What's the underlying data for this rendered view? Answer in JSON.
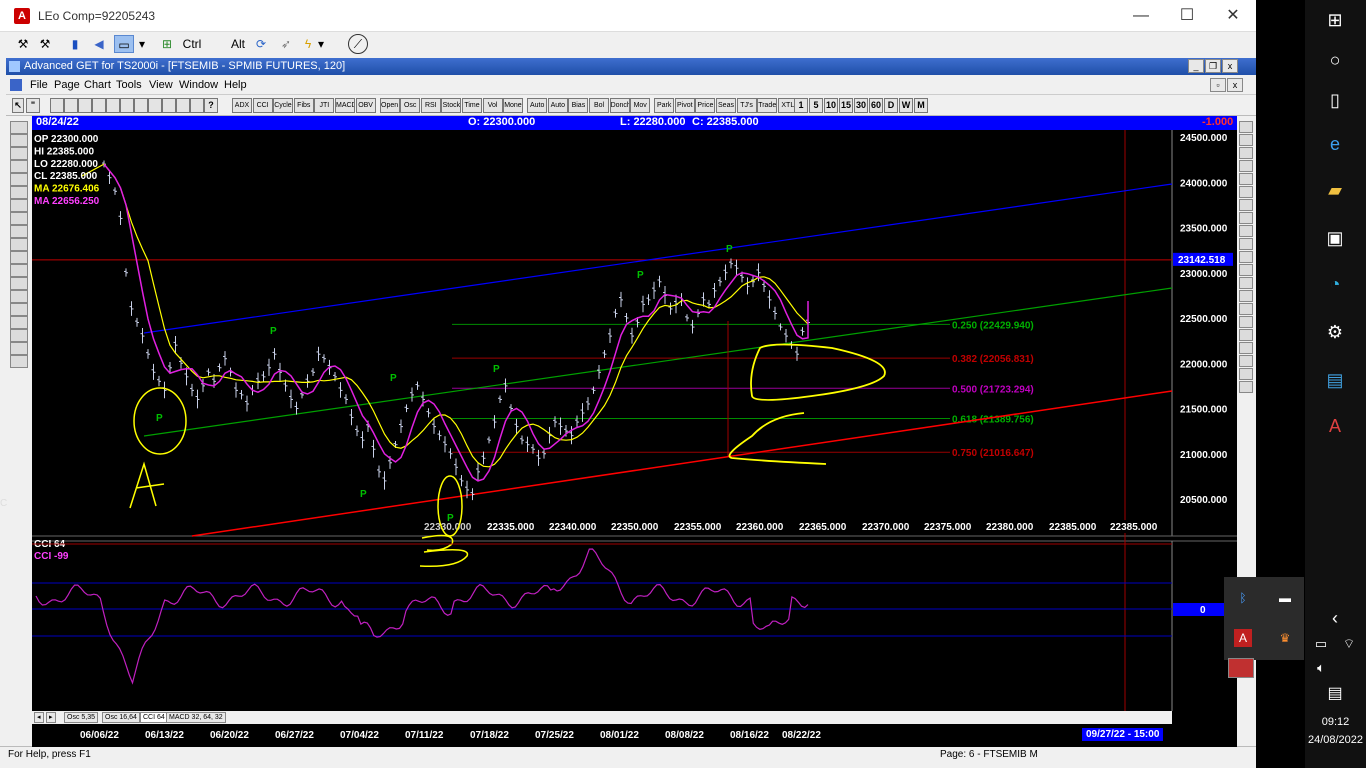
{
  "window": {
    "title": "LEo Comp=92205243",
    "app_icon": "A",
    "minimize": "—",
    "maximize": "☐",
    "close": "✕"
  },
  "toolbar": {
    "ctrl_label": "Ctrl",
    "alt_label": "Alt"
  },
  "inner_window": {
    "title": "Advanced GET for TS2000i - [FTSEMIB - SPMIB FUTURES, 120]"
  },
  "menu": [
    "File",
    "Page",
    "Chart",
    "Tools",
    "View",
    "Window",
    "Help"
  ],
  "indicator_buttons": [
    "ADX DMI",
    "CCI",
    "Cycles",
    "Fibs",
    "JTI",
    "MACD",
    "OBV",
    "Open Int",
    "Osc",
    "RSI",
    "Stock",
    "Time Cust",
    "Vol",
    "Money Flow",
    "Auto Gann",
    "Auto Trend",
    "Bias",
    "Bol Band",
    "Donch",
    "Mov Ave",
    "Park Pars",
    "Pivot",
    "Price Clust",
    "Seas onals",
    "TJ's Web",
    "Trade Profile",
    "XTL"
  ],
  "timeframe_buttons": [
    "1",
    "5",
    "10",
    "15",
    "30",
    "60",
    "D",
    "W",
    "M"
  ],
  "info_bar": {
    "date": "08/24/22",
    "open": "O: 22300.000",
    "low": "L:  22280.000",
    "close": "C:  22385.000",
    "change": "-1.000"
  },
  "ohlc_box": {
    "op": "OP  22300.000",
    "hi": "HI   22385.000",
    "lo": "LO  22280.000",
    "cl": "CL  22385.000",
    "ma1": "MA  22676.406",
    "ma2": "MA  22656.250"
  },
  "price_axis": [
    "24500.000",
    "24000.000",
    "23500.000",
    "23000.000",
    "22500.000",
    "22000.000",
    "21500.000",
    "21000.000",
    "20500.000"
  ],
  "current_price": "23142.518",
  "fib_levels": [
    {
      "label": "0.250 (22429.940)",
      "color": "#00b000"
    },
    {
      "label": "0.382 (22056.831)",
      "color": "#c00000"
    },
    {
      "label": "0.500 (21723.294)",
      "color": "#c000c0"
    },
    {
      "label": "0.618 (21389.756)",
      "color": "#00b000"
    },
    {
      "label": "0.750 (21016.647)",
      "color": "#c00000"
    }
  ],
  "time_price_axis": [
    "22335.000",
    "22340.000",
    "22350.000",
    "22355.000",
    "22360.000",
    "22365.000",
    "22370.000",
    "22375.000",
    "22380.000",
    "22385.000",
    "22385.000"
  ],
  "time_price_first": "22330.000",
  "cci": {
    "label": "CCI 64",
    "value": "CCI  -99",
    "zero_label": "0"
  },
  "tabs": [
    "Osc 5,35",
    "Osc 16,64",
    "CCI 64",
    "MACD 32, 64, 32"
  ],
  "dates": [
    "06/06/22",
    "06/13/22",
    "06/20/22",
    "06/27/22",
    "07/04/22",
    "07/11/22",
    "07/18/22",
    "07/25/22",
    "08/01/22",
    "08/08/22",
    "08/16/22",
    "08/22/22"
  ],
  "end_date": "09/27/22 - 15:00",
  "status": {
    "help": "For Help, press F1",
    "page": "Page: 6 - FTSEMIB M"
  },
  "clock": {
    "time": "09:12",
    "date": "24/08/2022"
  },
  "pivot_label": "P",
  "annotation_letters": [
    "A",
    "B"
  ],
  "left_edge_char": "C",
  "colors": {
    "price_bars": "#c8d0e8",
    "ma_yellow": "#ffff00",
    "ma_magenta": "#e020e0",
    "trend_blue": "#0000ff",
    "trend_green": "#00a000",
    "trend_red": "#ff0000",
    "pivot": "#00c000"
  }
}
